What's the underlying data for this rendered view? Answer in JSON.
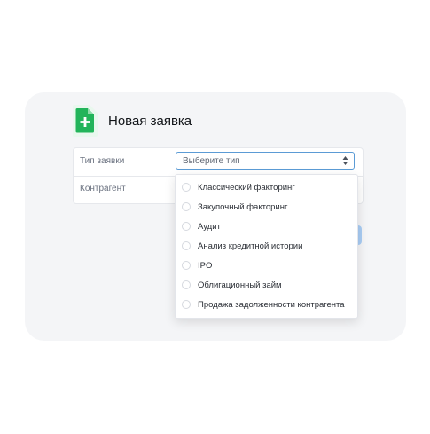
{
  "header": {
    "title": "Новая заявка",
    "icon": "document-add-icon",
    "icon_color": "#22b45a"
  },
  "form": {
    "fields": [
      {
        "label": "Тип заявки",
        "placeholder": "Выберите тип"
      },
      {
        "label": "Контрагент"
      }
    ]
  },
  "dropdown": {
    "options": [
      "Классический факторинг",
      "Закупочный факторинг",
      "Аудит",
      "Анализ кредитной истории",
      "IPO",
      "Облигационный займ",
      "Продажа задолженности контрагента"
    ]
  },
  "colors": {
    "card_bg": "#f4f5f7",
    "select_border": "#5b9bd5",
    "accent_tab": "#a9cdf4"
  }
}
